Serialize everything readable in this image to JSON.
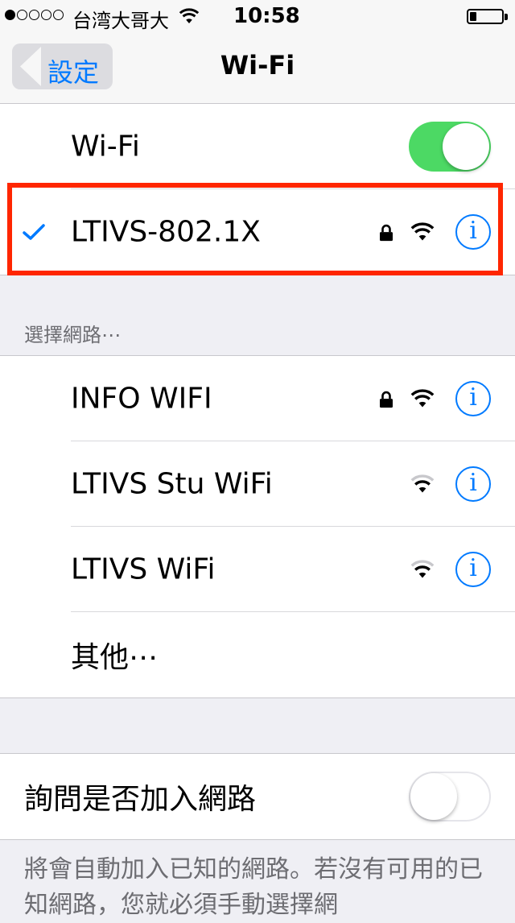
{
  "status_bar": {
    "signal_strength": 1,
    "carrier": "台湾大哥大",
    "time": "10:58",
    "battery_level": 0.2
  },
  "nav": {
    "back_label": "設定",
    "title": "Wi-Fi"
  },
  "wifi_toggle": {
    "label": "Wi-Fi",
    "enabled": true
  },
  "connected_network": {
    "name": "LTIVS-802.1X",
    "secured": true,
    "signal_bars": 3
  },
  "section_header": "選擇網路⋯",
  "networks": [
    {
      "name": "INFO WIFI",
      "secured": true,
      "signal_bars": 3
    },
    {
      "name": "LTIVS Stu WiFi",
      "secured": false,
      "signal_bars": 2
    },
    {
      "name": "LTIVS WiFi",
      "secured": false,
      "signal_bars": 2
    }
  ],
  "other_label": "其他⋯",
  "ask_to_join": {
    "label": "詢問是否加入網路",
    "enabled": false
  },
  "footer_text": "將會自動加入已知的網路。若沒有可用的已知網路，您就必須手動選擇網",
  "colors": {
    "accent": "#007aff",
    "toggle_on": "#4cd964",
    "highlight": "#ff2600",
    "background": "#efeff4"
  },
  "icons": {
    "secured": "lock-icon",
    "signal": "wifi-signal-icon",
    "details": "info-icon",
    "connected": "checkmark-icon"
  }
}
